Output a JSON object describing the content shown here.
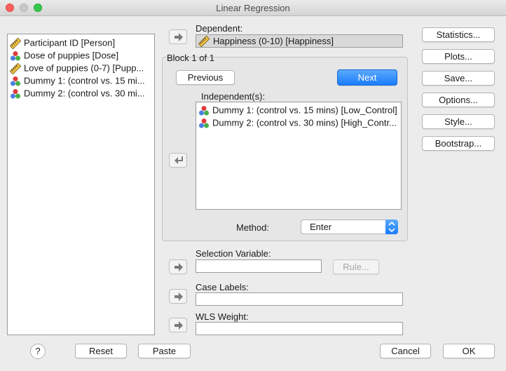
{
  "window": {
    "title": "Linear Regression"
  },
  "variables": [
    {
      "label": "Participant ID [Person]",
      "icon": "ruler-scale-icon"
    },
    {
      "label": "Dose of puppies [Dose]",
      "icon": "nominal-icon"
    },
    {
      "label": "Love of puppies (0-7) [Pupp...",
      "icon": "ruler-scale-icon"
    },
    {
      "label": "Dummy 1: (control vs. 15 mi...",
      "icon": "nominal-icon"
    },
    {
      "label": "Dummy 2: (control vs. 30 mi...",
      "icon": "nominal-icon"
    }
  ],
  "dependent": {
    "label": "Dependent:",
    "value": "Happiness (0-10) [Happiness]"
  },
  "block": {
    "title": "Block 1 of 1",
    "previous": "Previous",
    "next": "Next",
    "independents_label": "Independent(s):",
    "independents": [
      "Dummy 1: (control vs. 15 mins) [Low_Control]",
      "Dummy 2: (control vs. 30 mins) [High_Contr..."
    ],
    "method_label": "Method:",
    "method_value": "Enter"
  },
  "selection": {
    "label": "Selection Variable:",
    "rule": "Rule..."
  },
  "case_labels": {
    "label": "Case Labels:"
  },
  "wls": {
    "label": "WLS Weight:"
  },
  "side_buttons": {
    "statistics": "Statistics...",
    "plots": "Plots...",
    "save": "Save...",
    "options": "Options...",
    "style": "Style...",
    "bootstrap": "Bootstrap..."
  },
  "footer": {
    "help": "?",
    "reset": "Reset",
    "paste": "Paste",
    "cancel": "Cancel",
    "ok": "OK"
  },
  "colors": {
    "accent": "#1a7dfb",
    "red": "#fc605c",
    "green": "#34c84a"
  }
}
